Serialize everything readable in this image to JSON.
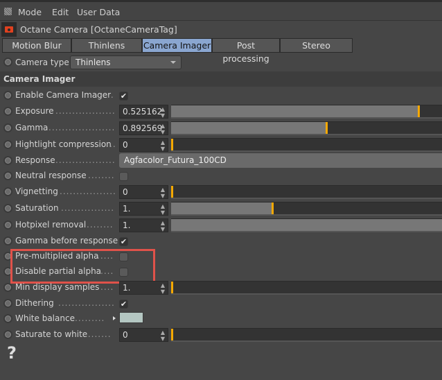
{
  "menu": {
    "items": [
      "Mode",
      "Edit",
      "User Data"
    ]
  },
  "header": {
    "title": "Octane Camera [OctaneCameraTag]"
  },
  "tabs": [
    {
      "label": "Motion Blur",
      "active": false
    },
    {
      "label": "Thinlens",
      "active": false
    },
    {
      "label": "Camera Imager",
      "active": true
    },
    {
      "label": "Post processing",
      "active": false
    },
    {
      "label": "Stereo",
      "active": false
    }
  ],
  "camera_type": {
    "label": "Camera type",
    "value": "Thinlens"
  },
  "section": {
    "title": "Camera Imager"
  },
  "rows": {
    "enable": {
      "label": "Enable Camera Imager",
      "checked": true
    },
    "exposure": {
      "label": "Exposure",
      "value": "0.525162",
      "slider_percent": 91
    },
    "gamma": {
      "label": "Gamma",
      "value": "0.892569",
      "slider_percent": 57
    },
    "highlight": {
      "label": "Hightlight compression",
      "value": "0",
      "slider_percent": 0
    },
    "response": {
      "label": "Response",
      "value": "Agfacolor_Futura_100CD"
    },
    "neutral": {
      "label": "Neutral response",
      "checked": false
    },
    "vignetting": {
      "label": "Vignetting",
      "value": "0",
      "slider_percent": 0
    },
    "saturation": {
      "label": "Saturation",
      "value": "1.",
      "slider_percent": 37
    },
    "hotpixel": {
      "label": "Hotpixel removal",
      "value": "1.",
      "slider_percent": 100
    },
    "gamma_before": {
      "label": "Gamma before response",
      "checked": true
    },
    "premult": {
      "label": "Pre-multiplied alpha",
      "checked": false
    },
    "disable_partial": {
      "label": "Disable partial alpha",
      "checked": false
    },
    "min_samples": {
      "label": "Min display samples",
      "value": "1.",
      "slider_percent": 0
    },
    "dithering": {
      "label": "Dithering",
      "checked": true
    },
    "white_balance": {
      "label": "White balance",
      "color": "#b4c7c2"
    },
    "saturate_white": {
      "label": "Saturate to white",
      "value": "0",
      "slider_percent": 0
    }
  },
  "help": {
    "label": "?"
  },
  "colors": {
    "accent": "#f5a800",
    "active_tab": "#8aa6d0",
    "highlight_box": "#e0524a"
  }
}
